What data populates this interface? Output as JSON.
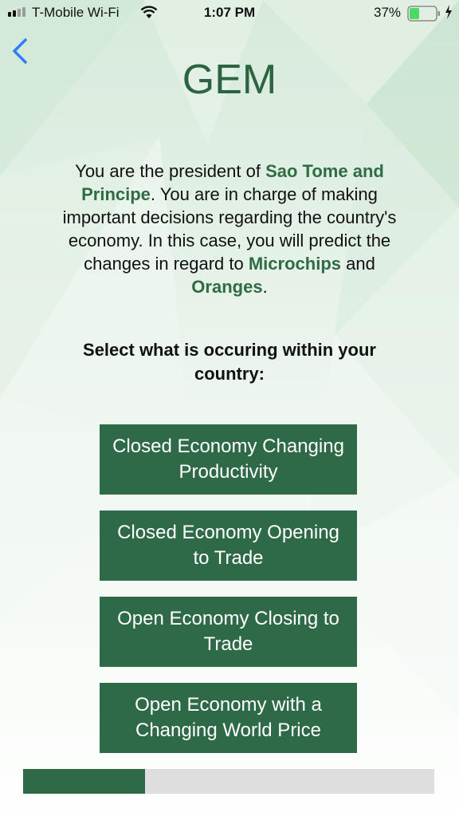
{
  "status_bar": {
    "carrier": "T-Mobile Wi-Fi",
    "time": "1:07 PM",
    "battery_percent": "37%",
    "icons": [
      "signal-icon",
      "wifi-icon",
      "battery-icon",
      "charging-icon"
    ]
  },
  "nav": {
    "back_icon": "chevron-left-icon"
  },
  "header": {
    "title": "GEM"
  },
  "intro": {
    "part1": "You are the president of ",
    "country": "Sao Tome and Principe",
    "part2": ". You are in charge of making important decisions regarding the country's economy. In this case, you will predict the changes in regard to ",
    "good1": "Microchips",
    "part3": " and ",
    "good2": "Oranges",
    "part4": "."
  },
  "prompt": "Select what is occuring within your country:",
  "options": [
    {
      "label": "Closed Economy Changing Productivity"
    },
    {
      "label": "Closed Economy Opening to Trade"
    },
    {
      "label": "Open Economy Closing to Trade"
    },
    {
      "label": "Open Economy with a Changing World Price"
    }
  ],
  "progress": {
    "fraction": 0.297
  },
  "colors": {
    "accent": "#2e6a47",
    "title": "#2b6440",
    "highlight": "#2f6b45",
    "back": "#2f7ff6",
    "progress_track": "#dedede",
    "battery": "#4cd964"
  }
}
